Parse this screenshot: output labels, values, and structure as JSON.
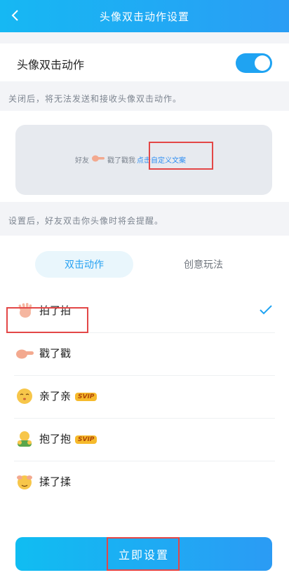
{
  "header": {
    "title": "头像双击动作设置"
  },
  "toggle": {
    "label": "头像双击动作",
    "on": true
  },
  "hints": {
    "disabled": "关闭后，将无法发送和接收头像双击动作。",
    "after": "设置后，好友双击你头像时将会提醒。"
  },
  "preview": {
    "prefix": "好友",
    "verb": "戳了戳我",
    "custom": "点击自定义文案"
  },
  "tabs": [
    {
      "label": "双击动作",
      "active": true
    },
    {
      "label": "创意玩法",
      "active": false
    }
  ],
  "actions": [
    {
      "label": "拍了拍",
      "icon": "hand-wave-icon",
      "selected": true,
      "svip": false
    },
    {
      "label": "戳了戳",
      "icon": "finger-poke-icon",
      "selected": false,
      "svip": false
    },
    {
      "label": "亲了亲",
      "icon": "kiss-face-icon",
      "selected": false,
      "svip": true,
      "badge": "SVIP"
    },
    {
      "label": "抱了抱",
      "icon": "hug-icon",
      "selected": false,
      "svip": true,
      "badge": "SVIP"
    },
    {
      "label": "揉了揉",
      "icon": "rub-face-icon",
      "selected": false,
      "svip": false
    }
  ],
  "footer": {
    "button": "立即设置"
  },
  "colors": {
    "accent": "#1fa3f2",
    "highlight": "#e34747",
    "svip": "#f6ba2c"
  }
}
